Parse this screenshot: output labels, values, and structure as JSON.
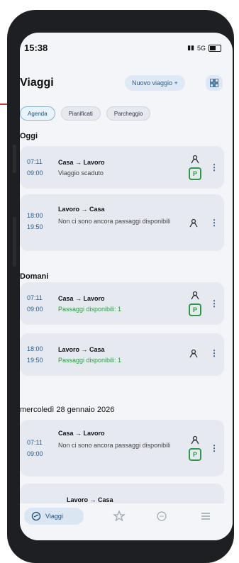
{
  "status": {
    "time": "15:38",
    "network": "5G"
  },
  "header": {
    "title": "Viaggi",
    "new_trip": "Nuovo viaggio +"
  },
  "filters": [
    "Agenda",
    "Pianificati",
    "Parcheggio"
  ],
  "sections": [
    {
      "title": "Oggi",
      "cards": [
        {
          "t1": "07:11",
          "t2": "09:00",
          "route": "Casa → Lavoro",
          "detail": "Viaggio scaduto",
          "detail_color": "gray",
          "parking": true
        },
        {
          "t1": "18:00",
          "t2": "19:50",
          "route": "Lavoro → Casa",
          "detail": "Non ci sono ancora passaggi disponibili",
          "detail_color": "gray",
          "parking": false
        }
      ]
    },
    {
      "title": "Domani",
      "cards": [
        {
          "t1": "07:11",
          "t2": "09:00",
          "route": "Casa → Lavoro",
          "detail": "Passaggi disponibili: 1",
          "detail_color": "green",
          "parking": true
        },
        {
          "t1": "18:00",
          "t2": "19:50",
          "route": "Lavoro → Casa",
          "detail": "Passaggi disponibili: 1",
          "detail_color": "green",
          "parking": false
        }
      ]
    },
    {
      "title": "mercoledì 28 gennaio 2026",
      "cards": [
        {
          "t1": "07:11",
          "t2": "09:00",
          "route": "Casa → Lavoro",
          "detail": "Non ci sono ancora passaggi disponibili",
          "detail_color": "gray",
          "parking": true
        },
        {
          "t1": "",
          "t2": "",
          "route": "Lavoro → Casa",
          "detail": "",
          "detail_color": "gray",
          "parking": false
        }
      ]
    }
  ],
  "navbar": {
    "active_label": "Viaggi"
  },
  "colors": {
    "accent": "#2a5a8a",
    "green": "#2e9a45"
  }
}
